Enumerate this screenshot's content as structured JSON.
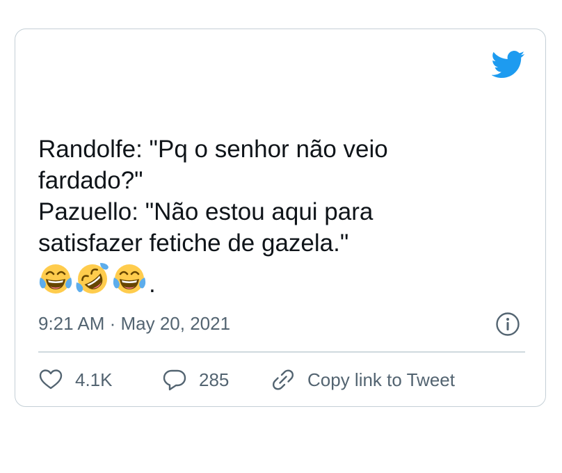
{
  "tweet": {
    "text_lines": [
      "Randolfe: \"Pq o senhor não veio",
      "fardado?\"",
      "Pazuello: \"Não estou aqui para",
      "satisfazer fetiche de gazela.\""
    ],
    "trailing_punct": ".",
    "emojis": [
      "face-with-tears-of-joy",
      "rolling-on-the-floor-laughing",
      "face-with-tears-of-joy"
    ],
    "timestamp": "9:21 AM · May 20, 2021"
  },
  "actions": {
    "likes": "4.1K",
    "replies": "285",
    "copy_link": "Copy link to Tweet"
  },
  "icons": {
    "brand": "twitter-bird-icon",
    "info": "info-icon",
    "like": "heart-icon",
    "reply": "reply-bubble-icon",
    "link": "link-icon"
  },
  "colors": {
    "brand": "#1d9bf0",
    "secondary_text": "#536471",
    "primary_text": "#0f1419",
    "border": "#c4cfd6"
  }
}
